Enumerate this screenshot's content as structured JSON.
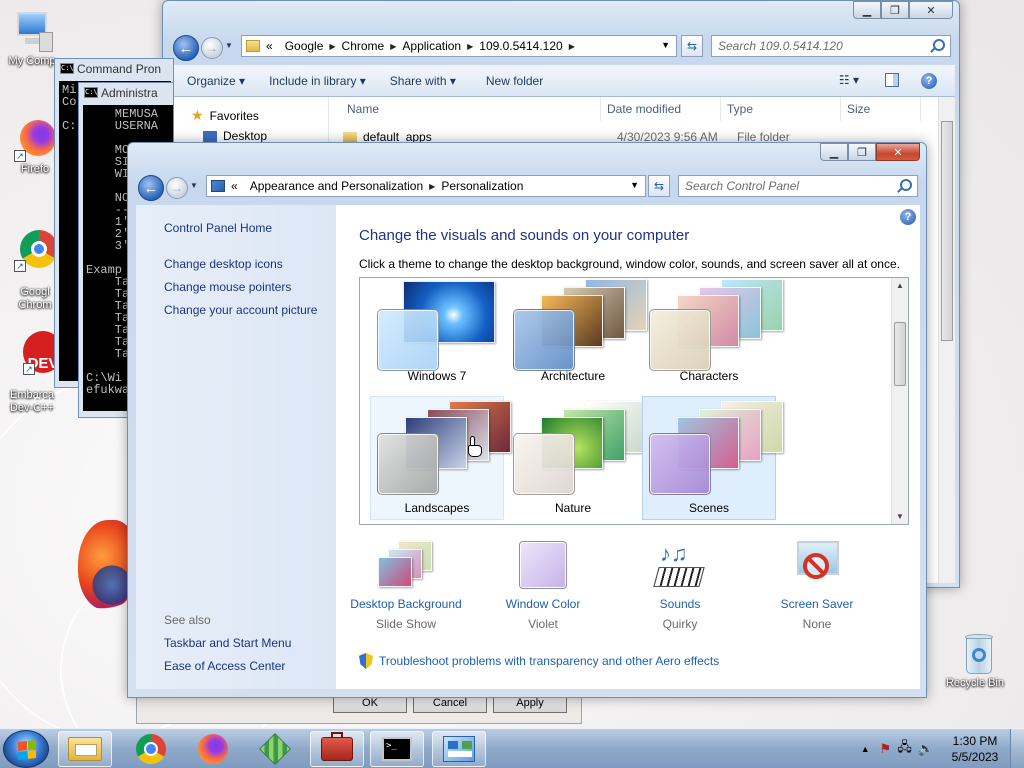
{
  "desktop": {
    "icons": [
      {
        "label": "My Comp",
        "icon": "computer-icon"
      },
      {
        "label": "Firefo",
        "icon": "firefox-icon"
      },
      {
        "label": "Googl\nChrom",
        "icon": "chrome-icon"
      },
      {
        "label": "Embarca\nDev-C++",
        "icon": "devcpp-icon"
      },
      {
        "label": "Recycle Bin",
        "icon": "recycle-bin-icon"
      }
    ],
    "devcpp_badge": "DEV",
    "devcpp_plus": "C++"
  },
  "cmd_back": {
    "title": "Command Pron",
    "lines": "Mi\nCo\n\nC:"
  },
  "cmd_front": {
    "title": "Administra",
    "lines": "    MEMUSA\n    USERNA\n\n    MO\n    SI\n    WI\n\n    NO\n    --\n    1'\n    2'\n    3'\n\nExamp\n    Ta\n    Ta\n    Ta\n    Ta\n    Ta\n    Ta\n    Ta\n\nC:\\Wi\nefukwa"
  },
  "explorer": {
    "address": {
      "overflow": "«",
      "segments": [
        "Google",
        "Chrome",
        "Application",
        "109.0.5414.120"
      ]
    },
    "search_placeholder": "Search 109.0.5414.120",
    "toolbar": [
      "Organize ▾",
      "Include in library ▾",
      "Share with ▾",
      "New folder"
    ],
    "nav": {
      "favorites": "Favorites",
      "desktop": "Desktop"
    },
    "columns": [
      "Name",
      "Date modified",
      "Type",
      "Size"
    ],
    "rows": [
      {
        "name": "default_apps",
        "date": "4/30/2023 9:56 AM",
        "type": "File folder"
      }
    ],
    "behind_buttons": [
      "OK",
      "Cancel",
      "Apply"
    ]
  },
  "personalization": {
    "address": {
      "overflow": "«",
      "segments": [
        "Appearance and Personalization",
        "Personalization"
      ]
    },
    "search_placeholder": "Search Control Panel",
    "sidebar": {
      "home": "Control Panel Home",
      "links": [
        "Change desktop icons",
        "Change mouse pointers",
        "Change your account picture"
      ],
      "see_also_heading": "See also",
      "see_also": [
        "Taskbar and Start Menu",
        "Ease of Access Center"
      ]
    },
    "heading": "Change the visuals and sounds on your computer",
    "subheading": "Click a theme to change the desktop background, window color, sounds, and screen saver all at once.",
    "themes": [
      "Windows 7",
      "Architecture",
      "Characters",
      "Landscapes",
      "Nature",
      "Scenes"
    ],
    "selected_theme": "Scenes",
    "bottom": [
      {
        "title": "Desktop Background",
        "value": "Slide Show",
        "icon": "desktop-background-icon"
      },
      {
        "title": "Window Color",
        "value": "Violet",
        "icon": "window-color-icon"
      },
      {
        "title": "Sounds",
        "value": "Quirky",
        "icon": "sounds-icon"
      },
      {
        "title": "Screen Saver",
        "value": "None",
        "icon": "screen-saver-icon"
      }
    ],
    "troubleshoot": "Troubleshoot problems with transparency and other Aero effects"
  },
  "taskbar": {
    "pinned": [
      "explorer-icon",
      "chrome-icon",
      "firefox-icon",
      "package-icon",
      "toolbox-icon",
      "cmd-icon",
      "control-panel-icon"
    ],
    "time": "1:30 PM",
    "date": "5/5/2023"
  },
  "colors": {
    "accent": "#1e5fb0",
    "link": "#1e3287",
    "selection": "#dfeefc"
  }
}
